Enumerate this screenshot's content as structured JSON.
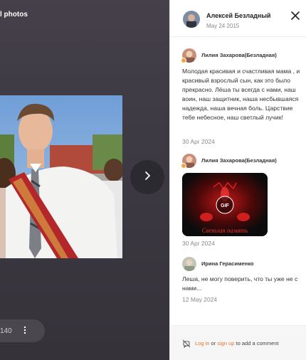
{
  "viewer": {
    "title": "l photos",
    "count": "140",
    "next_icon": "chevron-right-icon",
    "more_icon": "more-vertical-icon"
  },
  "panel": {
    "author_name": "Алексей Безладный",
    "post_date": "May 24 2015",
    "close_icon": "close-icon"
  },
  "comments": [
    {
      "author": "Лилия Захарова(Безладная)",
      "text": "Молодая красивая и счастливая мама , и красивый взрослый сын, как это было прекрасно. Лёша ты всегда с нами, наш воин, наш защитник, наша несбывшаяся надежда, наша вечная боль. Царствие тебе небесное, наш светлый лучик!",
      "date": "30 Apr 2024"
    },
    {
      "author": "Лилия Захарова(Безладная)",
      "gif_label": "GIF",
      "gif_caption": "Светлая память",
      "date": "30 Apr 2024"
    },
    {
      "author": "Ирина Герасименко",
      "text": "Леша, не могу поверить, что ты уже не с нами...",
      "date": "12 May 2024"
    }
  ],
  "footer": {
    "login": "Log in",
    "or": " or ",
    "signup": "sign up",
    "rest": " to add a comment",
    "lock_icon": "no-comment-icon"
  },
  "colors": {
    "accent": "#e8742a",
    "viewer_bg": "#3c3942",
    "badge": "#f2a53a"
  }
}
